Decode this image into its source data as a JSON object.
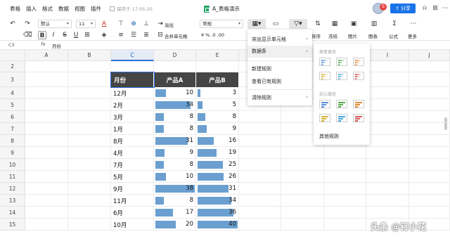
{
  "menubar": {
    "items": [
      "表格",
      "插入",
      "格式",
      "数据",
      "视图",
      "插件"
    ],
    "save_status": "保存于 17:05:20",
    "doc_title": "A_表格演示",
    "share_label": "分享",
    "avatar_badge": "S"
  },
  "toolbar": {
    "font_name": "默认",
    "font_size": "11",
    "wrap_label": "溢出",
    "merge_label": "合并单元格",
    "number_format": "常规",
    "labels": {
      "sort": "排序",
      "freeze": "冻结",
      "image": "图片",
      "chart": "图表",
      "formula": "公式",
      "more": "更多"
    }
  },
  "formula_bar": {
    "cell_ref": "C3",
    "fx": "fx",
    "value": "月份"
  },
  "grid": {
    "columns": [
      "A",
      "B",
      "C",
      "D",
      "E",
      "F",
      "G",
      "H",
      "I",
      "J"
    ],
    "rows": [
      "2",
      "3",
      "4",
      "5",
      "6",
      "7",
      "8",
      "9",
      "10",
      "11",
      "12",
      "13",
      "14",
      "15"
    ]
  },
  "table": {
    "headers": [
      "月份",
      "产品A",
      "产品B"
    ],
    "rows": [
      {
        "month": "12月",
        "a": "10",
        "b": "3"
      },
      {
        "month": "2月",
        "a": "34",
        "b": "5"
      },
      {
        "month": "3月",
        "a": "8",
        "b": "8"
      },
      {
        "month": "1月",
        "a": "8",
        "b": "9"
      },
      {
        "month": "8月",
        "a": "31",
        "b": "16"
      },
      {
        "month": "4月",
        "a": "9",
        "b": "19"
      },
      {
        "month": "7月",
        "a": "8",
        "b": "25"
      },
      {
        "month": "5月",
        "a": "10",
        "b": "26"
      },
      {
        "month": "9月",
        "a": "38",
        "b": "31"
      },
      {
        "month": "11月",
        "a": "8",
        "b": "34"
      },
      {
        "month": "6月",
        "a": "17",
        "b": "36"
      },
      {
        "month": "10月",
        "a": "20",
        "b": "40"
      }
    ],
    "max_a": 38,
    "max_b": 40,
    "bar_color": "#6b9fd0",
    "header_bg": "#454545"
  },
  "cf_menu": {
    "items": [
      "突出显示单元格",
      "数据条",
      "新建规则",
      "查看已有规则",
      "清除规则"
    ],
    "active": "数据条"
  },
  "databar_menu": {
    "gradient_title": "渐变填充",
    "solid_title": "实心填充",
    "other_rules": "其他规则",
    "colors": [
      "#5b8fd6",
      "#5aab52",
      "#e08a3a",
      "#d6b23a",
      "#4aa8d8",
      "#d65a5a"
    ]
  },
  "watermark": "头条 @钉小花"
}
